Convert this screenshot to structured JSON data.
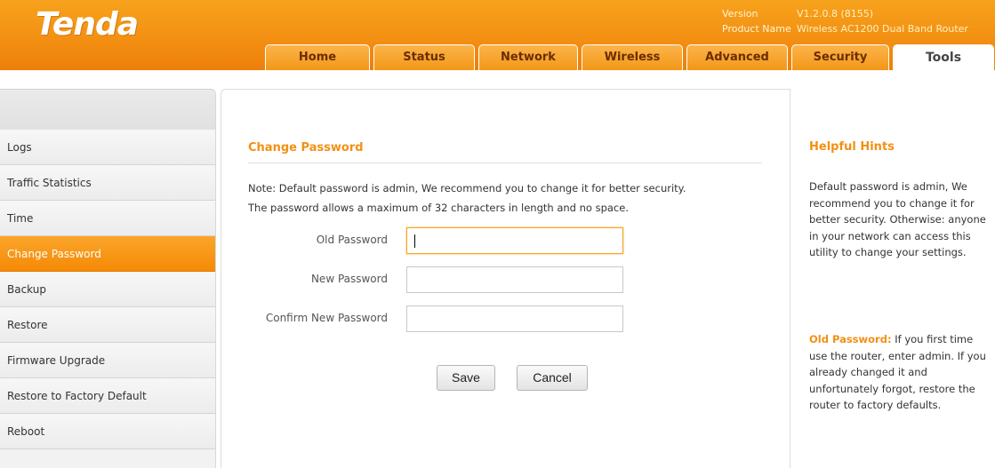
{
  "header": {
    "logo": "Tenda",
    "version_label": "Version",
    "version_value": "V1.2.0.8 (8155)",
    "product_label": "Product Name",
    "product_value": "Wireless AC1200 Dual Band Router"
  },
  "tabs": [
    {
      "label": "Home"
    },
    {
      "label": "Status"
    },
    {
      "label": "Network"
    },
    {
      "label": "Wireless"
    },
    {
      "label": "Advanced"
    },
    {
      "label": "Security"
    },
    {
      "label": "Tools",
      "active": true
    }
  ],
  "sidebar": {
    "items": [
      {
        "label": "Logs"
      },
      {
        "label": "Traffic Statistics"
      },
      {
        "label": "Time"
      },
      {
        "label": "Change Password",
        "active": true
      },
      {
        "label": "Backup"
      },
      {
        "label": "Restore"
      },
      {
        "label": "Firmware Upgrade"
      },
      {
        "label": "Restore to Factory Default"
      },
      {
        "label": "Reboot"
      }
    ]
  },
  "main": {
    "title": "Change Password",
    "note1": "Note: Default password is admin, We recommend you to change it for better security.",
    "note2": "The password allows a maximum of 32 characters in length and no space.",
    "old_password_label": "Old Password",
    "old_password_value": "",
    "new_password_label": "New Password",
    "new_password_value": "",
    "confirm_password_label": "Confirm New Password",
    "confirm_password_value": "",
    "save_label": "Save",
    "cancel_label": "Cancel"
  },
  "hints": {
    "title": "Helpful Hints",
    "text1": "Default password is admin, We recommend you to change it for better security. Otherwise: anyone in your network can access this utility to change your settings.",
    "old_password_key": "Old Password:",
    "old_password_text": " If you first time use the router, enter admin. If you already changed it and unfortunately forgot, restore the router to factory defaults."
  },
  "colors": {
    "accent": "#f39013",
    "header_orange": "#f39013",
    "tab_text": "#6b2d00"
  }
}
